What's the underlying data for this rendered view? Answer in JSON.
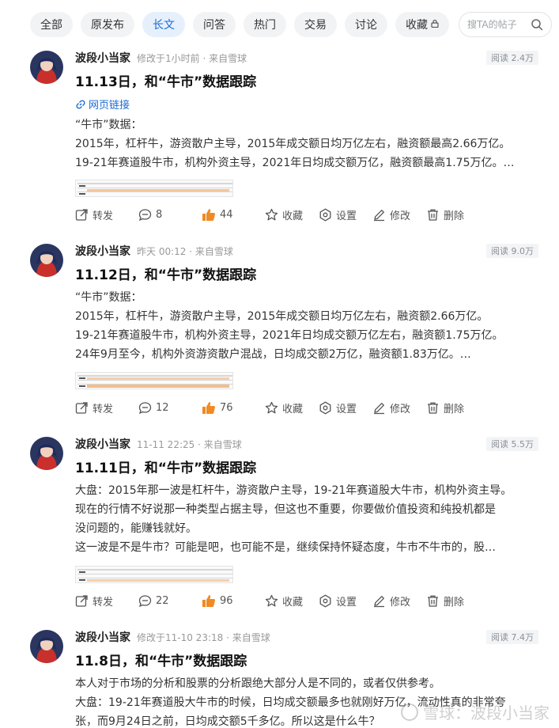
{
  "tabs": [
    {
      "label": "全部",
      "active": false
    },
    {
      "label": "原发布",
      "active": false
    },
    {
      "label": "长文",
      "active": true
    },
    {
      "label": "问答",
      "active": false
    },
    {
      "label": "热门",
      "active": false
    },
    {
      "label": "交易",
      "active": false
    },
    {
      "label": "讨论",
      "active": false
    },
    {
      "label": "收藏",
      "active": false
    }
  ],
  "search": {
    "placeholder": "搜TA的帖子"
  },
  "actions": {
    "repost": "转发",
    "favorite": "收藏",
    "settings": "设置",
    "edit": "修改",
    "delete": "删除"
  },
  "posts": [
    {
      "author": "波段小当家",
      "meta": "修改于1小时前 · 来自雪球",
      "reads": "阅读 2.4万",
      "title": "11.13日，和“牛市”数据跟踪",
      "link": "网页链接",
      "lines": [
        "“牛市”数据：",
        "2015年，杠杆牛，游资散户主导，2015年成交额日均万亿左右，融资额最高2.66万亿。",
        "19-21年赛道股牛市，机构外资主导，2021年日均成交额万亿，融资额最高1.75万亿。…"
      ],
      "comments": "8",
      "likes": "44"
    },
    {
      "author": "波段小当家",
      "meta": "昨天 00:12 · 来自雪球",
      "reads": "阅读 9.0万",
      "title": "11.12日，和“牛市”数据跟踪",
      "lines": [
        "“牛市”数据：",
        "2015年，杠杆牛，游资散户主导，2015年成交额日均万亿左右，融资额2.66万亿。",
        "19-21年赛道股牛市，机构外资主导，2021年日均成交额万亿左右，融资额1.75万亿。",
        "24年9月至今，机构外资游资散户混战，日均成交额2万亿，融资额1.83万亿。…"
      ],
      "comments": "12",
      "likes": "76"
    },
    {
      "author": "波段小当家",
      "meta": "11-11 22:25 · 来自雪球",
      "reads": "阅读 5.5万",
      "title": "11.11日，和“牛市”数据跟踪",
      "lines": [
        "大盘：2015年那一波是杠杆牛，游资散户主导，19-21年赛道股大牛市，机构外资主导。",
        "现在的行情不好说那一种类型占据主导，但这也不重要，你要做价值投资和纯投机都是",
        "没问题的，能赚钱就好。",
        "这一波是不是牛市？可能是吧，也可能不是，继续保持怀疑态度，牛市不牛市的，股…"
      ],
      "comments": "22",
      "likes": "96"
    },
    {
      "author": "波段小当家",
      "meta": "修改于11-10 23:18 · 来自雪球",
      "reads": "阅读 7.4万",
      "title": "11.8日，和“牛市”数据跟踪",
      "lines": [
        "本人对于市场的分析和股票的分析跟绝大部分人是不同的，或者仅供参考。",
        "大盘：19-21年赛道股大牛市的时候，日均成交额最多也就刚好万亿，流动性真的非常夸",
        "张，而9月24日之前，日均成交额5千多亿。所以这是什么牛？"
      ]
    }
  ],
  "watermark": "雪球：波段小当家",
  "colors": {
    "accent": "#1a6bd6",
    "like": "#f08a24",
    "tab_bg": "#f2f3f5",
    "tab_active_bg": "#e6f0fd"
  }
}
